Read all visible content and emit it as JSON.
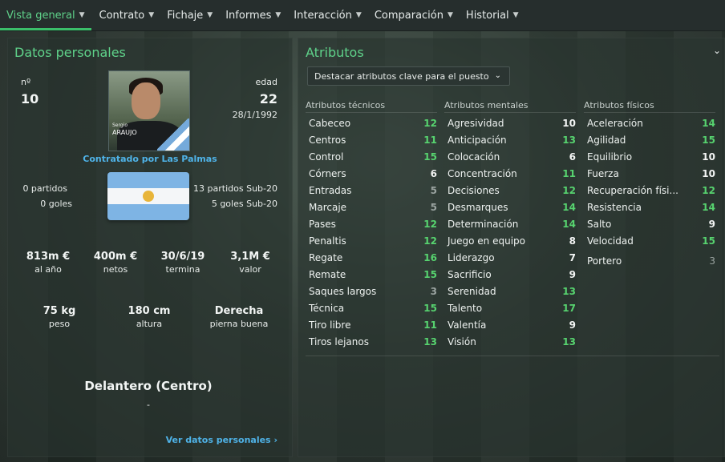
{
  "nav": {
    "tabs": [
      {
        "label": "Vista general",
        "active": true
      },
      {
        "label": "Contrato"
      },
      {
        "label": "Fichaje"
      },
      {
        "label": "Informes"
      },
      {
        "label": "Interacción"
      },
      {
        "label": "Comparación"
      },
      {
        "label": "Historial"
      }
    ]
  },
  "personal": {
    "title": "Datos personales",
    "number_label": "nº",
    "number": "10",
    "age_label": "edad",
    "age": "22",
    "dob": "28/1/1992",
    "photo_first": "Sergio",
    "photo_last": "ARAUJO",
    "contract_text": "Contratado por Las Palmas",
    "matches": "0 partidos",
    "goals": "0 goles",
    "u20_matches": "13 partidos Sub-20",
    "u20_goals": "5 goles Sub-20",
    "stats1": [
      {
        "value": "813m €",
        "label": "al año"
      },
      {
        "value": "400m €",
        "label": "netos"
      },
      {
        "value": "30/6/19",
        "label": "termina"
      },
      {
        "value": "3,1M €",
        "label": "valor"
      }
    ],
    "stats2": [
      {
        "value": "75 kg",
        "label": "peso"
      },
      {
        "value": "180 cm",
        "label": "altura"
      },
      {
        "value": "Derecha",
        "label": "pierna buena"
      }
    ],
    "position": "Delantero (Centro)",
    "position_sub": "-",
    "view_link": "Ver datos personales"
  },
  "attributes": {
    "title": "Atributos",
    "dropdown": "Destacar atributos clave para el puesto",
    "columns": [
      {
        "title": "Atributos técnicos",
        "rows": [
          {
            "name": "Cabeceo",
            "value": "12",
            "color": "green"
          },
          {
            "name": "Centros",
            "value": "11",
            "color": "green"
          },
          {
            "name": "Control",
            "value": "15",
            "color": "green"
          },
          {
            "name": "Córners",
            "value": "6",
            "color": "white"
          },
          {
            "name": "Entradas",
            "value": "5",
            "color": "grey"
          },
          {
            "name": "Marcaje",
            "value": "5",
            "color": "grey"
          },
          {
            "name": "Pases",
            "value": "12",
            "color": "green"
          },
          {
            "name": "Penaltis",
            "value": "12",
            "color": "green"
          },
          {
            "name": "Regate",
            "value": "16",
            "color": "green"
          },
          {
            "name": "Remate",
            "value": "15",
            "color": "green"
          },
          {
            "name": "Saques largos",
            "value": "3",
            "color": "grey"
          },
          {
            "name": "Técnica",
            "value": "15",
            "color": "green"
          },
          {
            "name": "Tiro libre",
            "value": "11",
            "color": "green"
          },
          {
            "name": "Tiros lejanos",
            "value": "13",
            "color": "green"
          }
        ]
      },
      {
        "title": "Atributos mentales",
        "rows": [
          {
            "name": "Agresividad",
            "value": "10",
            "color": "white"
          },
          {
            "name": "Anticipación",
            "value": "13",
            "color": "green"
          },
          {
            "name": "Colocación",
            "value": "6",
            "color": "white"
          },
          {
            "name": "Concentración",
            "value": "11",
            "color": "green"
          },
          {
            "name": "Decisiones",
            "value": "12",
            "color": "green"
          },
          {
            "name": "Desmarques",
            "value": "14",
            "color": "green"
          },
          {
            "name": "Determinación",
            "value": "14",
            "color": "green"
          },
          {
            "name": "Juego en equipo",
            "value": "8",
            "color": "white"
          },
          {
            "name": "Liderazgo",
            "value": "7",
            "color": "white"
          },
          {
            "name": "Sacrificio",
            "value": "9",
            "color": "white"
          },
          {
            "name": "Serenidad",
            "value": "13",
            "color": "green"
          },
          {
            "name": "Talento",
            "value": "17",
            "color": "green"
          },
          {
            "name": "Valentía",
            "value": "9",
            "color": "white"
          },
          {
            "name": "Visión",
            "value": "13",
            "color": "green"
          }
        ]
      },
      {
        "title": "Atributos físicos",
        "rows": [
          {
            "name": "Aceleración",
            "value": "14",
            "color": "green"
          },
          {
            "name": "Agilidad",
            "value": "15",
            "color": "green"
          },
          {
            "name": "Equilibrio",
            "value": "10",
            "color": "white"
          },
          {
            "name": "Fuerza",
            "value": "10",
            "color": "white"
          },
          {
            "name": "Recuperación físi...",
            "value": "12",
            "color": "green"
          },
          {
            "name": "Resistencia",
            "value": "14",
            "color": "green"
          },
          {
            "name": "Salto",
            "value": "9",
            "color": "white"
          },
          {
            "name": "Velocidad",
            "value": "15",
            "color": "green"
          }
        ],
        "extra": {
          "name": "Portero",
          "value": "3",
          "color": "grey"
        }
      }
    ]
  }
}
